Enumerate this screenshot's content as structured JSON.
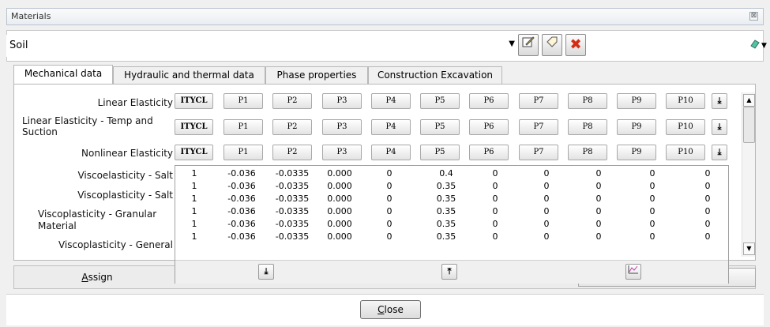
{
  "window": {
    "title": "Materials",
    "close_glyph": "⊠"
  },
  "material": {
    "selected": "Soil"
  },
  "toolbar": {
    "edit_icon": "edit-icon",
    "tag_icon": "tag-icon",
    "delete_icon": "delete-icon",
    "pencil_icon": "eraser-icon"
  },
  "tabs": [
    {
      "label": "Mechanical data"
    },
    {
      "label": "Hydraulic and thermal data"
    },
    {
      "label": "Phase properties"
    },
    {
      "label": "Construction Excavation"
    }
  ],
  "param_buttons": [
    "ITYCL",
    "P1",
    "P2",
    "P3",
    "P4",
    "P5",
    "P6",
    "P7",
    "P8",
    "P9",
    "P10"
  ],
  "rows": [
    {
      "label": "Linear Elasticity"
    },
    {
      "label": "Linear Elasticity - Temp and Suction"
    },
    {
      "label": "Nonlinear Elasticity"
    },
    {
      "label": "Viscoelasticity - Salt"
    },
    {
      "label": "Viscoplasticity - Salt"
    },
    {
      "label": "Viscoplasticity - Granular Material"
    },
    {
      "label": "Viscoplasticity - General"
    }
  ],
  "table": {
    "rows": [
      [
        "1",
        "-0.036",
        "-0.0335",
        "0.000",
        "0",
        "0.4",
        "0",
        "0",
        "0",
        "0",
        "0"
      ],
      [
        "1",
        "-0.036",
        "-0.0335",
        "0.000",
        "0",
        "0.35",
        "0",
        "0",
        "0",
        "0",
        "0"
      ],
      [
        "1",
        "-0.036",
        "-0.0335",
        "0.000",
        "0",
        "0.35",
        "0",
        "0",
        "0",
        "0",
        "0"
      ],
      [
        "1",
        "-0.036",
        "-0.0335",
        "0.000",
        "0",
        "0.35",
        "0",
        "0",
        "0",
        "0",
        "0"
      ],
      [
        "1",
        "-0.036",
        "-0.0335",
        "0.000",
        "0",
        "0.35",
        "0",
        "0",
        "0",
        "0",
        "0"
      ],
      [
        "1",
        "-0.036",
        "-0.0335",
        "0.000",
        "0",
        "0.35",
        "0",
        "0",
        "0",
        "0",
        "0"
      ]
    ]
  },
  "assign": {
    "label_pre": "",
    "label_key": "A",
    "label_post": "ssign"
  },
  "close": {
    "label_key": "C",
    "label_post": "lose"
  }
}
